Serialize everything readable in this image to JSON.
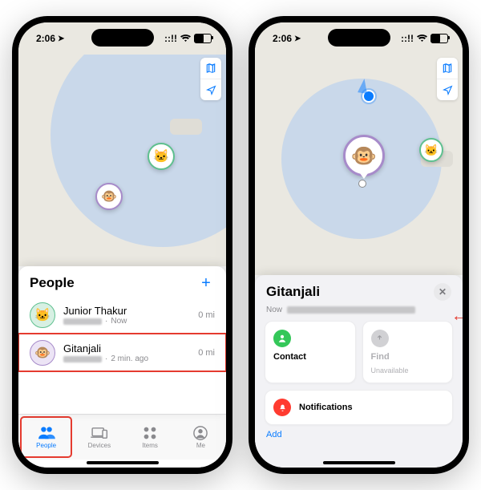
{
  "status": {
    "time": "2:06",
    "cellular_mode": "::!!"
  },
  "left_phone": {
    "sheet_title": "People",
    "people": [
      {
        "name": "Junior Thakur",
        "when": "Now",
        "distance": "0 mi"
      },
      {
        "name": "Gitanjali",
        "when": "2 min. ago",
        "distance": "0 mi"
      }
    ],
    "tabs": {
      "people": "People",
      "devices": "Devices",
      "items": "Items",
      "me": "Me"
    }
  },
  "right_phone": {
    "sheet_title": "Gitanjali",
    "subtitle_time": "Now",
    "cards": {
      "contact": "Contact",
      "find": "Find",
      "find_sub": "Unavailable",
      "notifications": "Notifications"
    },
    "add_link": "Add"
  }
}
